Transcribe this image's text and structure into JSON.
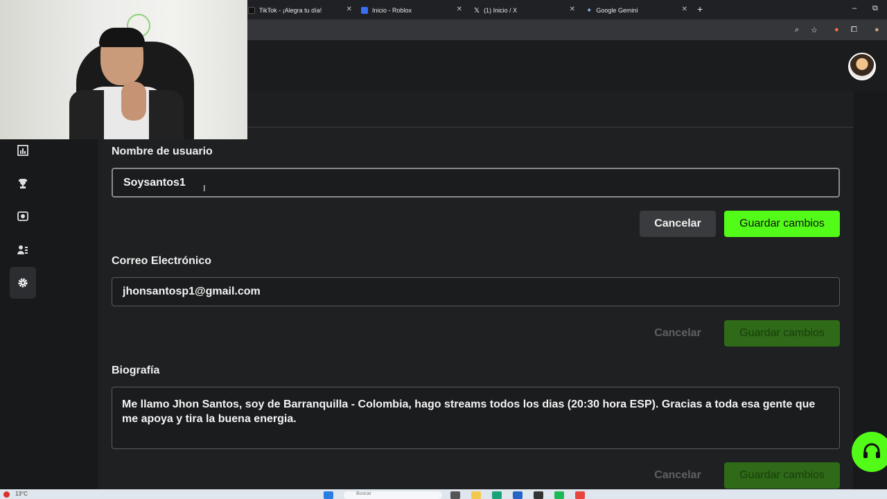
{
  "browser": {
    "tabs": [
      {
        "title": "TikTok - ¡Alegra tu día!",
        "favicon_color": "#111111"
      },
      {
        "title": "Inicio - Roblox",
        "favicon_color": "#3b6ff2"
      },
      {
        "title": "(1) Inicio / X",
        "favicon_color": "#111111"
      },
      {
        "title": "Google Gemini",
        "favicon_color": "#5b8af5"
      }
    ],
    "new_tab": "+"
  },
  "sidebar": {
    "items": [
      {
        "icon": "chart-icon"
      },
      {
        "icon": "trophy-icon"
      },
      {
        "icon": "camera-icon"
      },
      {
        "icon": "users-icon"
      },
      {
        "icon": "gear-icon",
        "active": true
      }
    ]
  },
  "form": {
    "username": {
      "label": "Nombre de usuario",
      "value": "Soysantos1",
      "cancel": "Cancelar",
      "save": "Guardar cambios"
    },
    "email": {
      "label": "Correo Electrónico",
      "value": "jhonsantosp1@gmail.com",
      "cancel": "Cancelar",
      "save": "Guardar cambios"
    },
    "bio": {
      "label": "Biografía",
      "value": "Me llamo Jhon Santos, soy de Barranquilla - Colombia, hago streams todos los dias (20:30 hora ESP). Gracias a toda esa gente que me apoya y tira la buena energia.",
      "cancel": "Cancelar",
      "save": "Guardar cambios"
    }
  },
  "colors": {
    "accent": "#53fc18",
    "accent_disabled": "#2e6a17",
    "background": "#18191b"
  },
  "taskbar": {
    "weather": "13°C",
    "search_placeholder": "Buscar"
  }
}
